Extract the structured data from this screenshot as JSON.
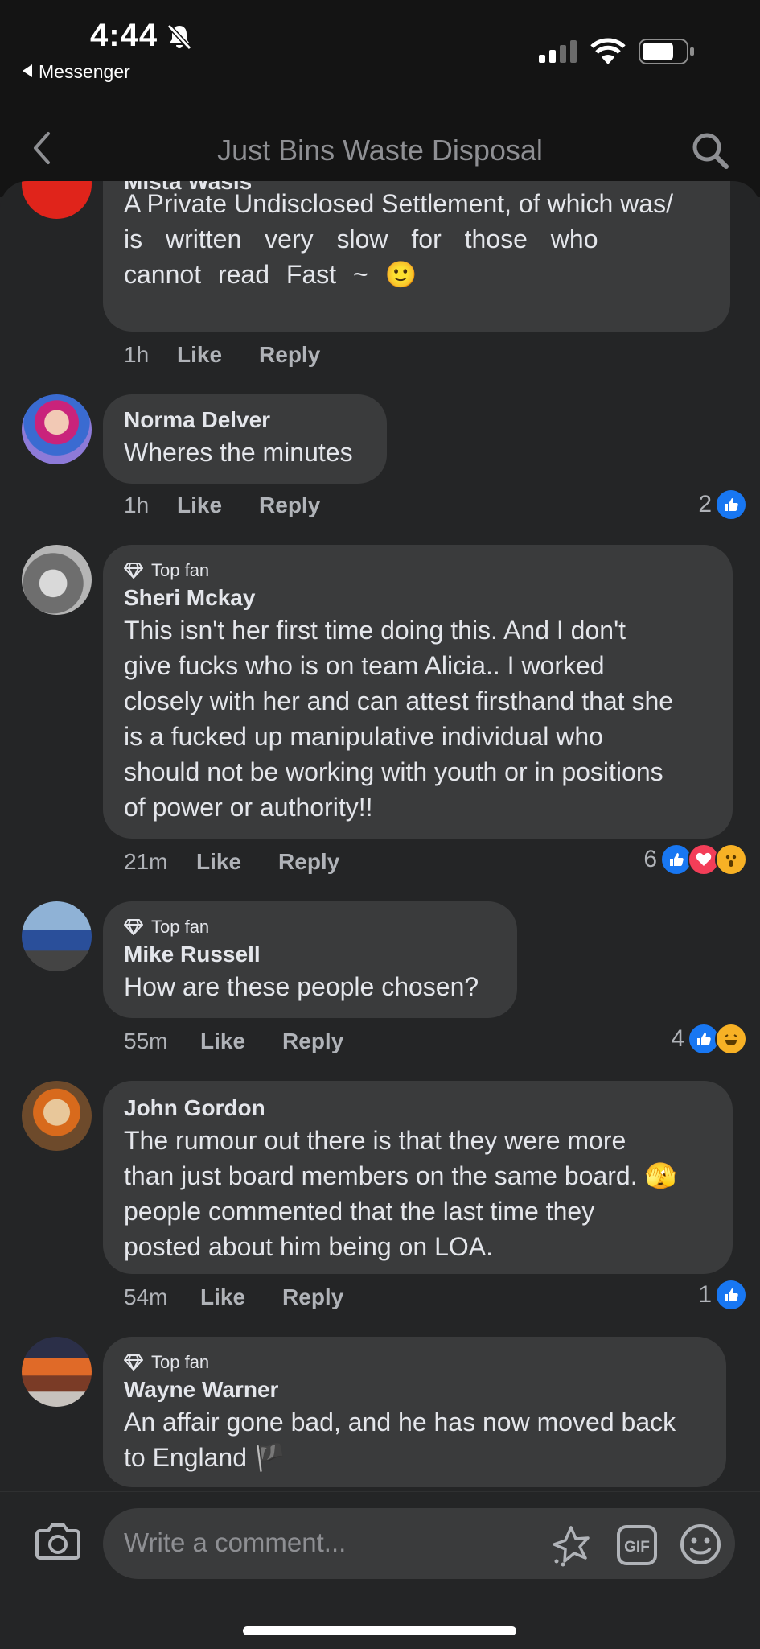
{
  "status": {
    "time": "4:44",
    "back_app": "Messenger"
  },
  "header": {
    "title": "Just Bins Waste Disposal"
  },
  "comments": [
    {
      "name": "Mista Wasis",
      "badge": "",
      "lines": [
        "A Private Undisclosed Settlement, of which was/",
        "is  written  very  slow  for  those  who",
        "cannot  read  Fast ~ 🙂"
      ],
      "time": "1h",
      "like": "Like",
      "reply": "Reply",
      "reaction_count": ""
    },
    {
      "name": "Norma Delver",
      "badge": "",
      "lines": [
        "Wheres the minutes"
      ],
      "time": "1h",
      "like": "Like",
      "reply": "Reply",
      "reaction_count": "2"
    },
    {
      "name": "Sheri Mckay",
      "badge": "Top fan",
      "lines": [
        "This isn't her first time doing this. And I don't",
        "give fucks who is on team Alicia.. I worked",
        "closely with her and can attest firsthand that she",
        "is a fucked up manipulative individual who",
        "should not be working with youth or in positions",
        "of power or authority!!"
      ],
      "time": "21m",
      "like": "Like",
      "reply": "Reply",
      "reaction_count": "6"
    },
    {
      "name": "Mike Russell",
      "badge": "Top fan",
      "lines": [
        "How are these people chosen?"
      ],
      "time": "55m",
      "like": "Like",
      "reply": "Reply",
      "reaction_count": "4"
    },
    {
      "name": "John Gordon",
      "badge": "",
      "lines": [
        "The rumour out there is that they were more",
        "than just board members on the same board. 🫣",
        "people commented that the last time they",
        "posted about him being on LOA."
      ],
      "time": "54m",
      "like": "Like",
      "reply": "Reply",
      "reaction_count": "1"
    },
    {
      "name": "Wayne Warner",
      "badge": "Top fan",
      "lines": [
        "An affair gone bad, and he has now moved back",
        "to England 🏴"
      ],
      "time": "",
      "like": "",
      "reply": "",
      "reaction_count": ""
    }
  ],
  "composer": {
    "placeholder": "Write a comment..."
  },
  "colors": {
    "like_blue": "#1877f2",
    "love_red": "#f33e58",
    "haha_yellow": "#f7b125"
  }
}
